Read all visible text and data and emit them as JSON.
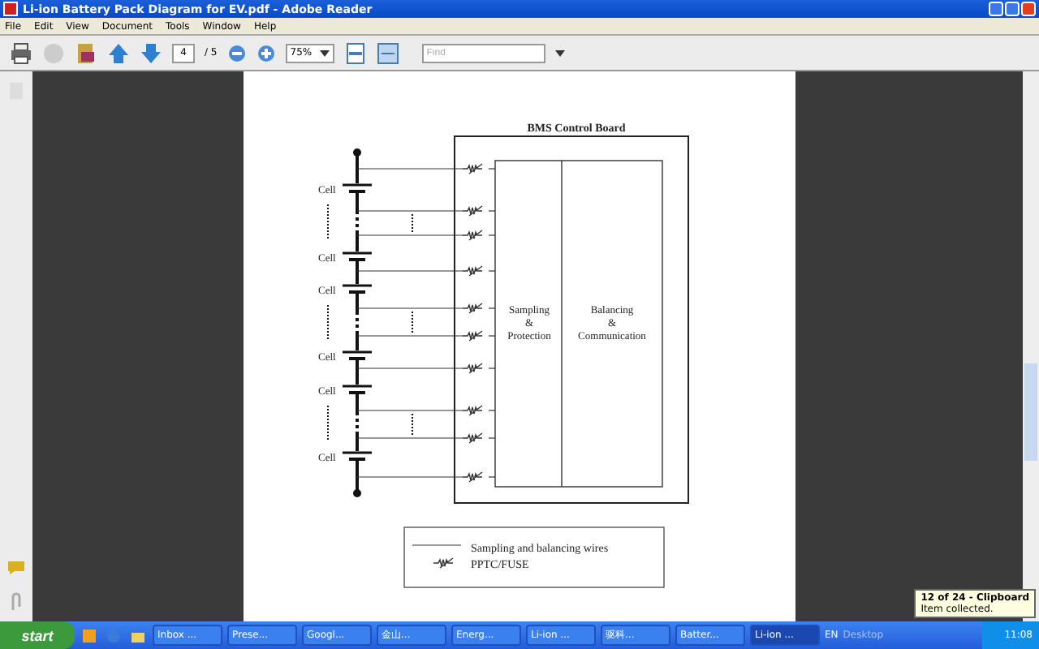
{
  "window": {
    "title": "Li-ion Battery Pack Diagram for EV.pdf - Adobe Reader"
  },
  "menu": [
    "File",
    "Edit",
    "View",
    "Document",
    "Tools",
    "Window",
    "Help"
  ],
  "toolbar": {
    "page": "4",
    "page_count": "/ 5",
    "zoom": "75%",
    "find_placeholder": "Find"
  },
  "diagram": {
    "title": "BMS Control Board",
    "cell_labels": [
      "Cell",
      "Cell",
      "Cell",
      "Cell",
      "Cell",
      "Cell"
    ],
    "blocks": [
      [
        "Sampling",
        "&",
        "Protection"
      ],
      [
        "Balancing",
        "&",
        "Communication"
      ]
    ],
    "legend": [
      "Sampling and balancing wires",
      "PPTC/FUSE"
    ]
  },
  "taskbar": {
    "start": "start",
    "tasks": [
      {
        "label": "Inbox ...",
        "selected": false
      },
      {
        "label": "Prese...",
        "selected": false
      },
      {
        "label": "Googl...",
        "selected": false
      },
      {
        "label": "金山...",
        "selected": false
      },
      {
        "label": "Energ...",
        "selected": false
      },
      {
        "label": "Li-ion ...",
        "selected": false
      },
      {
        "label": "驱科...",
        "selected": false
      },
      {
        "label": "Batter...",
        "selected": false
      },
      {
        "label": "Li-ion ...",
        "selected": true
      }
    ],
    "language": "EN",
    "desktop": "Desktop",
    "clock": "11:08"
  },
  "notification": {
    "title": "12 of 24 - Clipboard",
    "body": "Item collected."
  }
}
